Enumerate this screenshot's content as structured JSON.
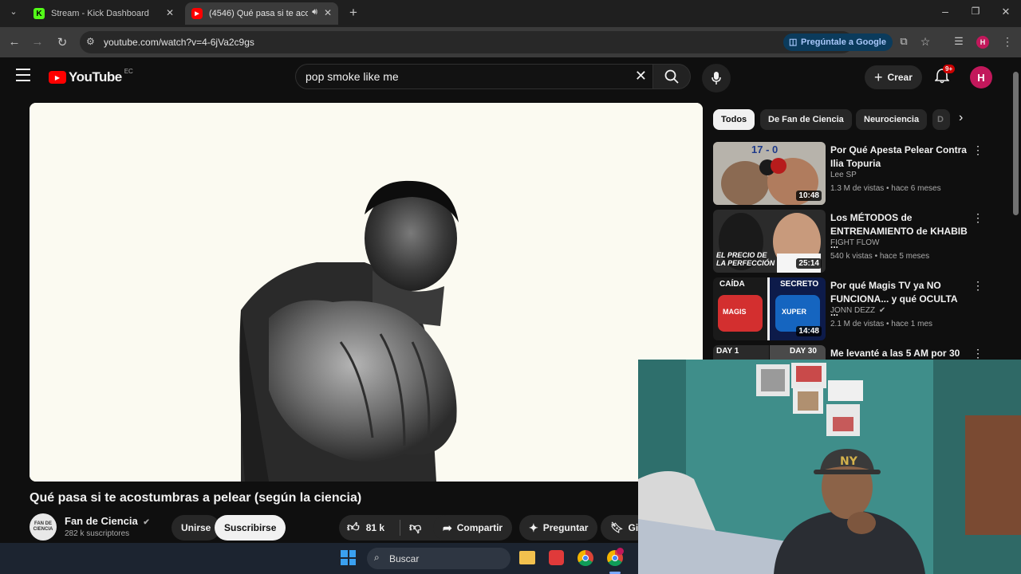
{
  "browser": {
    "tabs": [
      {
        "title": "Stream - Kick Dashboard",
        "favicon": "kick-icon",
        "active": false
      },
      {
        "title": "(4546) Qué pasa si te acost...",
        "favicon": "youtube-icon",
        "active": true
      }
    ],
    "url": "youtube.com/watch?v=4-6jVa2c9gs",
    "ask_google": "Pregúntale a Google",
    "profile_initial": "H"
  },
  "header": {
    "logo_text": "YouTube",
    "logo_country": "EC",
    "search_value": "pop smoke like me",
    "create_label": "Crear",
    "notifications_badge": "9+",
    "avatar_initial": "H"
  },
  "video": {
    "title": "Qué pasa si te acostumbras a pelear (según la ciencia)",
    "channel_name": "Fan de Ciencia",
    "channel_avatar_text": "FAN DE CIENCIA",
    "subscribers": "282 k suscriptores",
    "join_label": "Unirse",
    "subscribe_label": "Suscribirse",
    "likes": "81 k",
    "share_label": "Compartir",
    "ask_label": "Preguntar",
    "save_label_partial": "Gi"
  },
  "sidebar": {
    "chips": [
      "Todos",
      "De Fan de Ciencia",
      "Neurociencia",
      "D"
    ],
    "recommendations": [
      {
        "title": "Por Qué Apesta Pelear Contra Ilia Topuria",
        "channel": "Lee SP",
        "meta": "1.3 M de vistas • hace 6 meses",
        "duration": "10:48",
        "thumb_text": "17 - 0"
      },
      {
        "title": "Los MÉTODOS de ENTRENAMIENTO de KHABIB ...",
        "channel": "FIGHT FLOW",
        "meta": "540 k vistas • hace 5 meses",
        "duration": "25:14",
        "thumb_text": "EL PRECIO DE LA PERFECCIÓN"
      },
      {
        "title": "Por qué Magis TV ya NO FUNCIONA... y qué OCULTA ...",
        "channel": "JONN DEZZ",
        "meta": "2.1 M de vistas • hace 1 mes",
        "duration": "14:48",
        "thumb_left": "CAÍDA",
        "thumb_right": "SECRETO",
        "thumb_logo1": "MAGIS",
        "thumb_logo2": "XUPER"
      },
      {
        "title": "Me levanté a las 5 AM por 30",
        "thumb_left": "DAY 1",
        "thumb_right": "DAY 30"
      }
    ]
  },
  "taskbar": {
    "search_placeholder": "Buscar"
  },
  "colors": {
    "background": "#0f0f0f",
    "youtube_red": "#ff0000",
    "chip_active": "#f1f1f1",
    "avatar": "#c2185b",
    "kick_green": "#53fc18"
  }
}
